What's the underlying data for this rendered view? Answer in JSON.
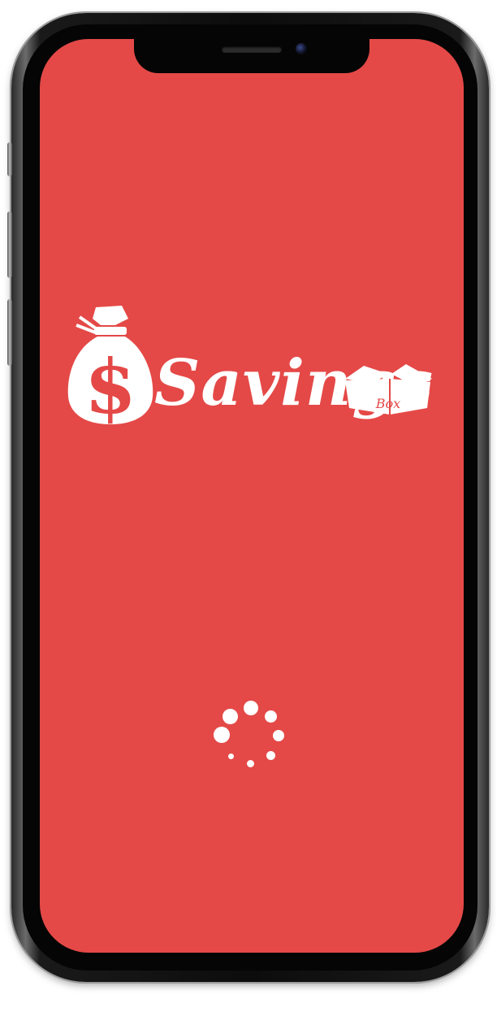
{
  "app": {
    "brand_word": "Savings",
    "box_label": "Box"
  },
  "screen": {
    "background_color": "#e44947",
    "foreground_color": "#ffffff",
    "state": "loading"
  },
  "icons": {
    "logo_bag": "money-bag-dollar",
    "logo_box": "open-box",
    "loader": "dots-spinner"
  }
}
